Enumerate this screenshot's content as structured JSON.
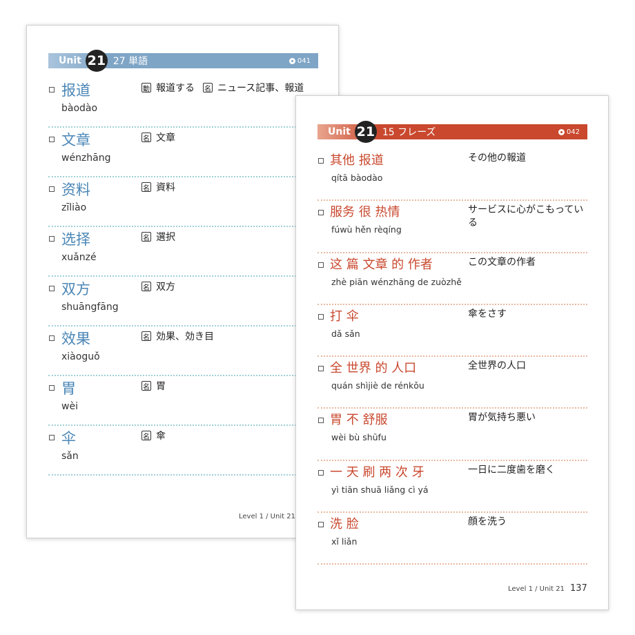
{
  "left_page": {
    "unit_word": "Unit",
    "unit_number": "21",
    "title": "27 単語",
    "track": "041",
    "entries": [
      {
        "word": "报道",
        "pinyin": "bàodào",
        "pos": "動",
        "meaning": "報道する",
        "pos2": "名",
        "meaning2": "ニュース記事、報道"
      },
      {
        "word": "文章",
        "pinyin": "wénzhāng",
        "pos": "名",
        "meaning": "文章"
      },
      {
        "word": "资料",
        "pinyin": "zīliào",
        "pos": "名",
        "meaning": "資料"
      },
      {
        "word": "选择",
        "pinyin": "xuǎnzé",
        "pos": "名",
        "meaning": "選択"
      },
      {
        "word": "双方",
        "pinyin": "shuāngfāng",
        "pos": "名",
        "meaning": "双方"
      },
      {
        "word": "效果",
        "pinyin": "xiàoguǒ",
        "pos": "名",
        "meaning": "効果、効き目"
      },
      {
        "word": "胃",
        "pinyin": "wèi",
        "pos": "名",
        "meaning": "胃"
      },
      {
        "word": "伞",
        "pinyin": "sǎn",
        "pos": "名",
        "meaning": "傘"
      }
    ],
    "footer": "Level 1 / Unit 21"
  },
  "right_page": {
    "unit_word": "Unit",
    "unit_number": "21",
    "title": "15 フレーズ",
    "track": "042",
    "entries": [
      {
        "phrase": "其他 报道",
        "pinyin": "qítā   bàodào",
        "meaning": "その他の報道"
      },
      {
        "phrase": "服务 很 热情",
        "pinyin": "fúwù   hěn rèqíng",
        "meaning": "サービスに心がこもっている"
      },
      {
        "phrase": "这 篇 文章 的 作者",
        "pinyin": "zhè piān wénzhāng de zuòzhě",
        "meaning": "この文章の作者"
      },
      {
        "phrase": "打 伞",
        "pinyin": "dǎ  sǎn",
        "meaning": "傘をさす"
      },
      {
        "phrase": "全 世界 的 人口",
        "pinyin": "quán shìjiè  de   rénkǒu",
        "meaning": "全世界の人口"
      },
      {
        "phrase": "胃 不 舒服",
        "pinyin": "wèi  bù  shūfu",
        "meaning": "胃が気持ち悪い"
      },
      {
        "phrase": "一 天 刷 两 次 牙",
        "pinyin": "yì tiān shuā liǎng cì  yá",
        "meaning": "一日に二度歯を磨く"
      },
      {
        "phrase": "洗 脸",
        "pinyin": "xǐ  liǎn",
        "meaning": "顔を洗う"
      }
    ],
    "footer": "Level 1 / Unit 21",
    "page_number": "137"
  },
  "colors": {
    "left_accent": "#7fa5c6",
    "right_accent": "#c9482e",
    "word_blue": "#4a86b6",
    "phrase_red": "#c9482e"
  }
}
